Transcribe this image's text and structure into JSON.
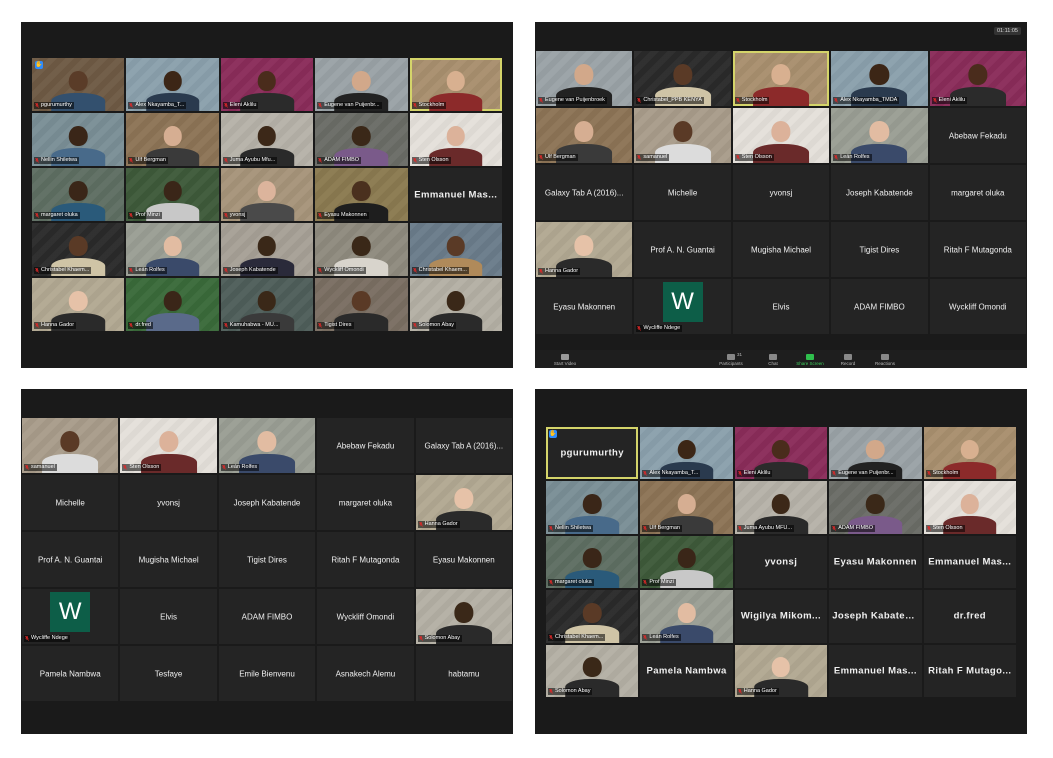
{
  "panels": {
    "top_left": {
      "tiles": [
        {
          "name": "pgurumurthy",
          "type": "video",
          "hand": true,
          "bg": "#6e5a44",
          "skin": "#5a3c28",
          "shirt": "#33506e"
        },
        {
          "name": "Alex Nkayamba_T...",
          "type": "video",
          "bg": "#8aa0ac",
          "skin": "#3c2616",
          "shirt": "#2a3a4e"
        },
        {
          "name": "Eleni Aklilu",
          "type": "video",
          "bg": "#8a2c5a",
          "skin": "#4a2c1c",
          "shirt": "#2b2b2b"
        },
        {
          "name": "Eugene van Puijenbr...",
          "type": "video",
          "bg": "#9aa2a6",
          "skin": "#d2a88a",
          "shirt": "#222"
        },
        {
          "name": "Stockholm",
          "type": "video",
          "active": true,
          "bg": "#a88f6e",
          "skin": "#d8b090",
          "shirt": "#8c2a2a"
        },
        {
          "name": "Nellin Shiletwa",
          "type": "video",
          "bg": "#7a8e96",
          "skin": "#3a2618",
          "shirt": "#486a8a"
        },
        {
          "name": "Ulf Bergman",
          "type": "video",
          "bg": "#8c7456",
          "skin": "#d6ae92",
          "shirt": "#3a3a3a"
        },
        {
          "name": "Juma Ayubu Mfu...",
          "type": "video",
          "bg": "#b6b2a8",
          "skin": "#3c2818",
          "shirt": "#2a2a2a"
        },
        {
          "name": "ADAM FIMBO",
          "type": "video",
          "bg": "#6a6c66",
          "skin": "#3a2818",
          "shirt": "#7a5a8a"
        },
        {
          "name": "Sten Olsson",
          "type": "video",
          "bg": "#e4e0da",
          "skin": "#dcb29a",
          "shirt": "#6a2a2a"
        },
        {
          "name": "margaret oluka",
          "type": "video",
          "bg": "#5e6e62",
          "skin": "#3a2618",
          "shirt": "#2a5a7a"
        },
        {
          "name": "Prof Minzi",
          "type": "video",
          "bg": "#3e5a3a",
          "skin": "#3a2618",
          "shirt": "#c8c8c8"
        },
        {
          "name": "yvonsj",
          "type": "video",
          "bg": "#a6947a",
          "skin": "#dcb49c",
          "shirt": "#4a4a4a"
        },
        {
          "name": "Eyasu Makonnen",
          "type": "video",
          "bg": "#8a7a50",
          "skin": "#4a301e",
          "shirt": "#1e1e1e"
        },
        {
          "name": "Emmanuel Mas...",
          "type": "text",
          "bold": true
        },
        {
          "name": "Christabel Khaem...",
          "type": "video",
          "bg": "#2a2a2a",
          "skin": "#5a3a26",
          "shirt": "#cfc4a6"
        },
        {
          "name": "Leán Rolfes",
          "type": "video",
          "bg": "#9a9e94",
          "skin": "#e2bca2",
          "shirt": "#3a4a6a"
        },
        {
          "name": "Joseph Kabatende",
          "type": "video",
          "bg": "#a6a096",
          "skin": "#3a2818",
          "shirt": "#2a2a3a"
        },
        {
          "name": "Wyckliff Omondi",
          "type": "video",
          "bg": "#8e8a7e",
          "skin": "#3a2818",
          "shirt": "#d8d4cc"
        },
        {
          "name": "Christabel Khaem...",
          "type": "video",
          "bg": "#6a7c8a",
          "skin": "#5a3a26",
          "shirt": "#b08a5a"
        },
        {
          "name": "Hanna Gador",
          "type": "video",
          "bg": "#b2a892",
          "skin": "#e6c2a8",
          "shirt": "#2a2a2a"
        },
        {
          "name": "dr.fred",
          "type": "video",
          "bg": "#3a6a3a",
          "skin": "#3a2618",
          "shirt": "#5a6a8a"
        },
        {
          "name": "Kamuhabwa - MU...",
          "type": "video",
          "bg": "#4e5e5a",
          "skin": "#3a2818",
          "shirt": "#3a3a3a"
        },
        {
          "name": "Tigist Dires",
          "type": "video",
          "bg": "#7a6e62",
          "skin": "#5a3a26",
          "shirt": "#2a2a2a"
        },
        {
          "name": "Solomon Abay",
          "type": "video",
          "bg": "#b4b0a4",
          "skin": "#3a2818",
          "shirt": "#2a2a2a"
        }
      ]
    },
    "top_right": {
      "timer": "01:11:05",
      "tiles": [
        {
          "name": "Eugene van Puijenbroek",
          "type": "video",
          "bg": "#9aa2a6",
          "skin": "#d2a88a",
          "shirt": "#222"
        },
        {
          "name": "Christabel_PPB KENYA",
          "type": "video",
          "bg": "#2a2a2a",
          "skin": "#5a3a26",
          "shirt": "#cfc4a6"
        },
        {
          "name": "Stockholm",
          "type": "video",
          "active": true,
          "bg": "#a88f6e",
          "skin": "#d8b090",
          "shirt": "#8c2a2a"
        },
        {
          "name": "Alex Nkayamba_TMDA",
          "type": "video",
          "bg": "#8aa0ac",
          "skin": "#3c2616",
          "shirt": "#2a3a4e"
        },
        {
          "name": "Eleni Aklilu",
          "type": "video",
          "bg": "#8a2c5a",
          "skin": "#4a2c1c",
          "shirt": "#2b2b2b"
        },
        {
          "name": "Ulf Bergman",
          "type": "video",
          "bg": "#8c7456",
          "skin": "#d6ae92",
          "shirt": "#3a3a3a"
        },
        {
          "name": "samanuel",
          "type": "video",
          "bg": "#a89c8a",
          "skin": "#5a3a26",
          "shirt": "#dcdcdc"
        },
        {
          "name": "Sten Olsson",
          "type": "video",
          "bg": "#e4e0da",
          "skin": "#dcb29a",
          "shirt": "#6a2a2a"
        },
        {
          "name": "Leán Rolfes",
          "type": "video",
          "bg": "#9a9e94",
          "skin": "#e2bca2",
          "shirt": "#3a4a6a"
        },
        {
          "name": "Abebaw Fekadu",
          "type": "text"
        },
        {
          "name": "Galaxy Tab A (2016)...",
          "type": "text"
        },
        {
          "name": "Michelle",
          "type": "text"
        },
        {
          "name": "yvonsj",
          "type": "text"
        },
        {
          "name": "Joseph Kabatende",
          "type": "text"
        },
        {
          "name": "margaret oluka",
          "type": "text"
        },
        {
          "name": "Hanna Gador",
          "type": "video",
          "bg": "#b2a892",
          "skin": "#e6c2a8",
          "shirt": "#2a2a2a"
        },
        {
          "name": "Prof A. N. Guantai",
          "type": "text"
        },
        {
          "name": "Mugisha Michael",
          "type": "text"
        },
        {
          "name": "Tigist Dires",
          "type": "text"
        },
        {
          "name": "Ritah F Mutagonda",
          "type": "text"
        },
        {
          "name": "Eyasu Makonnen",
          "type": "text"
        },
        {
          "name": "Wycliffe Ndege",
          "type": "avatar",
          "letter": "W"
        },
        {
          "name": "Elvis",
          "type": "text"
        },
        {
          "name": "ADAM FIMBO",
          "type": "text"
        },
        {
          "name": "Wyckliff Omondi",
          "type": "text"
        }
      ],
      "toolbar": {
        "start_video": "Start Video",
        "participants": "Participants",
        "participants_count": "31",
        "chat": "Chat",
        "share_screen": "Share Screen",
        "record": "Record",
        "reactions": "Reactions"
      }
    },
    "bottom_left": {
      "tiles": [
        {
          "name": "samanuel",
          "type": "video",
          "bg": "#a89c8a",
          "skin": "#5a3a26",
          "shirt": "#dcdcdc"
        },
        {
          "name": "Sten Olsson",
          "type": "video",
          "bg": "#e4e0da",
          "skin": "#dcb29a",
          "shirt": "#6a2a2a"
        },
        {
          "name": "Leán Rolfes",
          "type": "video",
          "bg": "#9a9e94",
          "skin": "#e2bca2",
          "shirt": "#3a4a6a"
        },
        {
          "name": "Abebaw Fekadu",
          "type": "text"
        },
        {
          "name": "Galaxy Tab A (2016)...",
          "type": "text"
        },
        {
          "name": "Michelle",
          "type": "text"
        },
        {
          "name": "yvonsj",
          "type": "text"
        },
        {
          "name": "Joseph Kabatende",
          "type": "text"
        },
        {
          "name": "margaret oluka",
          "type": "text"
        },
        {
          "name": "Hanna Gador",
          "type": "video",
          "bg": "#b2a892",
          "skin": "#e6c2a8",
          "shirt": "#2a2a2a"
        },
        {
          "name": "Prof A. N. Guantai",
          "type": "text"
        },
        {
          "name": "Mugisha Michael",
          "type": "text"
        },
        {
          "name": "Tigist Dires",
          "type": "text"
        },
        {
          "name": "Ritah F Mutagonda",
          "type": "text"
        },
        {
          "name": "Eyasu Makonnen",
          "type": "text"
        },
        {
          "name": "Wycliffe Ndege",
          "type": "avatar",
          "letter": "W"
        },
        {
          "name": "Elvis",
          "type": "text"
        },
        {
          "name": "ADAM FIMBO",
          "type": "text"
        },
        {
          "name": "Wyckliff Omondi",
          "type": "text"
        },
        {
          "name": "Solomon Abay",
          "type": "video",
          "bg": "#b4b0a4",
          "skin": "#3a2818",
          "shirt": "#2a2a2a"
        },
        {
          "name": "Pamela Nambwa",
          "type": "text"
        },
        {
          "name": "Tesfaye",
          "type": "text"
        },
        {
          "name": "Emile Bienvenu",
          "type": "text"
        },
        {
          "name": "Asnakech Alemu",
          "type": "text"
        },
        {
          "name": "habtamu",
          "type": "text"
        }
      ]
    },
    "bottom_right": {
      "tiles": [
        {
          "name": "pgurumurthy",
          "type": "text",
          "bold": true,
          "hand": true,
          "active": true
        },
        {
          "name": "Alex Nkayamba_T...",
          "type": "video",
          "bg": "#8aa0ac",
          "skin": "#3c2616",
          "shirt": "#2a3a4e"
        },
        {
          "name": "Eleni Aklilu",
          "type": "video",
          "bg": "#8a2c5a",
          "skin": "#4a2c1c",
          "shirt": "#2b2b2b"
        },
        {
          "name": "Eugene van Puijenbr...",
          "type": "video",
          "bg": "#9aa2a6",
          "skin": "#d2a88a",
          "shirt": "#222"
        },
        {
          "name": "Stockholm",
          "type": "video",
          "bg": "#a88f6e",
          "skin": "#d8b090",
          "shirt": "#8c2a2a"
        },
        {
          "name": "Nellin Shiletwa",
          "type": "video",
          "bg": "#7a8e96",
          "skin": "#3a2618",
          "shirt": "#486a8a"
        },
        {
          "name": "Ulf Bergman",
          "type": "video",
          "bg": "#8c7456",
          "skin": "#d6ae92",
          "shirt": "#3a3a3a"
        },
        {
          "name": "Juma Ayubu MFU...",
          "type": "video",
          "bg": "#b6b2a8",
          "skin": "#3c2818",
          "shirt": "#2a2a2a"
        },
        {
          "name": "ADAM FIMBO",
          "type": "video",
          "bg": "#6a6c66",
          "skin": "#3a2818",
          "shirt": "#7a5a8a"
        },
        {
          "name": "Sten Olsson",
          "type": "video",
          "bg": "#e4e0da",
          "skin": "#dcb29a",
          "shirt": "#6a2a2a"
        },
        {
          "name": "margaret oluka",
          "type": "video",
          "bg": "#5e6e62",
          "skin": "#3a2618",
          "shirt": "#2a5a7a"
        },
        {
          "name": "Prof Minzi",
          "type": "video",
          "bg": "#3e5a3a",
          "skin": "#3a2618",
          "shirt": "#c8c8c8"
        },
        {
          "name": "yvonsj",
          "type": "text",
          "bold": true
        },
        {
          "name": "Eyasu Makonnen",
          "type": "text",
          "bold": true
        },
        {
          "name": "Emmanuel Mas...",
          "type": "text",
          "bold": true
        },
        {
          "name": "Christabel Khaem...",
          "type": "video",
          "bg": "#2a2a2a",
          "skin": "#5a3a26",
          "shirt": "#cfc4a6"
        },
        {
          "name": "Leán Rolfes",
          "type": "video",
          "bg": "#9a9e94",
          "skin": "#e2bca2",
          "shirt": "#3a4a6a"
        },
        {
          "name": "Wigilya Mikom...",
          "type": "text",
          "bold": true
        },
        {
          "name": "Joseph Kabaten...",
          "type": "text",
          "bold": true
        },
        {
          "name": "dr.fred",
          "type": "text",
          "bold": true
        },
        {
          "name": "Solomon Abay",
          "type": "video",
          "bg": "#b4b0a4",
          "skin": "#3a2818",
          "shirt": "#2a2a2a"
        },
        {
          "name": "Pamela Nambwa",
          "type": "text",
          "bold": true
        },
        {
          "name": "Hanna Gador",
          "type": "video",
          "bg": "#b2a892",
          "skin": "#e6c2a8",
          "shirt": "#2a2a2a"
        },
        {
          "name": "Emmanuel Mas...",
          "type": "text",
          "bold": true
        },
        {
          "name": "Ritah F Mutago...",
          "type": "text",
          "bold": true
        }
      ]
    }
  },
  "colors": {
    "active_speaker_border": "#d4d46a",
    "muted_mic": "#e02828",
    "raised_hand": "#2d8cff",
    "avatar_w": "#0d5e48",
    "share_screen": "#2fbf4d"
  },
  "icons": {
    "muted": "muted-mic-icon",
    "hand": "raised-hand-icon"
  }
}
